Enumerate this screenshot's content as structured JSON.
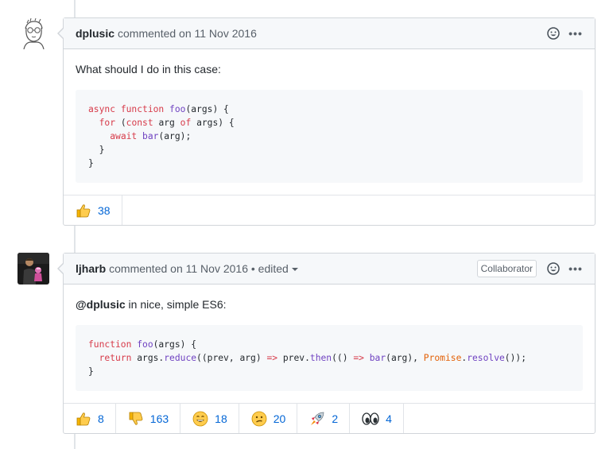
{
  "comments": [
    {
      "author": "dplusic",
      "meta": "commented on 11 Nov 2016",
      "body_text": "What should I do in this case:",
      "code_lines": [
        [
          [
            "kw",
            "async "
          ],
          [
            "kw",
            "function "
          ],
          [
            "fn",
            "foo"
          ],
          [
            "",
            "(args) {"
          ]
        ],
        [
          [
            "",
            "  "
          ],
          [
            "kw",
            "for "
          ],
          [
            "",
            "("
          ],
          [
            "kw",
            "const "
          ],
          [
            "",
            "arg "
          ],
          [
            "kw",
            "of "
          ],
          [
            "",
            "args) {"
          ]
        ],
        [
          [
            "",
            "    "
          ],
          [
            "kw",
            "await "
          ],
          [
            "fn",
            "bar"
          ],
          [
            "",
            "(arg);"
          ]
        ],
        [
          [
            "",
            "  }"
          ]
        ],
        [
          [
            "",
            "}"
          ]
        ]
      ],
      "reactions": [
        {
          "icon": "thumbs-up-icon",
          "count": "38"
        }
      ]
    },
    {
      "author": "ljharb",
      "meta": "commented on 11 Nov 2016 • edited",
      "badge": "Collaborator",
      "mention": "@dplusic",
      "body_text": " in nice, simple ES6:",
      "code_lines": [
        [
          [
            "kw",
            "function "
          ],
          [
            "fn",
            "foo"
          ],
          [
            "",
            "(args) {"
          ]
        ],
        [
          [
            "",
            "  "
          ],
          [
            "kw",
            "return "
          ],
          [
            "",
            "args."
          ],
          [
            "fn",
            "reduce"
          ],
          [
            "",
            "((prev, arg) "
          ],
          [
            "kw",
            "=>"
          ],
          [
            "",
            " prev."
          ],
          [
            "fn",
            "then"
          ],
          [
            "",
            "(() "
          ],
          [
            "kw",
            "=>"
          ],
          [
            "fn",
            " bar"
          ],
          [
            "",
            "(arg), "
          ],
          [
            "bi",
            "Promise"
          ],
          [
            "",
            "."
          ],
          [
            "fn",
            "resolve"
          ],
          [
            "",
            "());"
          ]
        ],
        [
          [
            "",
            "}"
          ]
        ]
      ],
      "reactions": [
        {
          "icon": "thumbs-up-icon",
          "count": "8"
        },
        {
          "icon": "thumbs-down-icon",
          "count": "163"
        },
        {
          "icon": "laugh-icon",
          "count": "18"
        },
        {
          "icon": "confused-icon",
          "count": "20"
        },
        {
          "icon": "rocket-icon",
          "count": "2"
        },
        {
          "icon": "eyes-icon",
          "count": "4"
        }
      ]
    }
  ],
  "colors": {
    "link": "#0366d6",
    "keyword": "#d73a49",
    "function": "#6f42c1",
    "builtin": "#e36209"
  }
}
